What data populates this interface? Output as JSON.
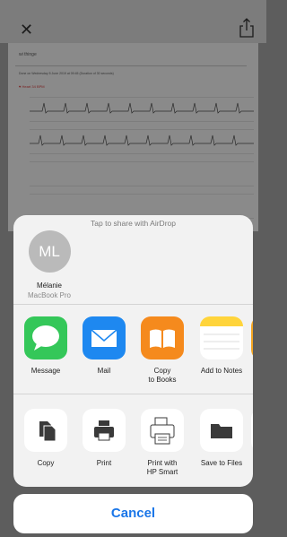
{
  "doc": {
    "user": "wi thinge",
    "meta": "Done on Wednesday 5 June 2019 at 09:45 (Duration of 30 seconds)",
    "heart": "Heart 34 BPM"
  },
  "share": {
    "airdrop_hint": "Tap to share with AirDrop",
    "contact": {
      "initials": "ML",
      "name": "Mélanie",
      "device": "MacBook Pro"
    },
    "apps": [
      {
        "label": "Message",
        "icon": "message-icon",
        "color": "#34c759"
      },
      {
        "label": "Mail",
        "icon": "mail-icon",
        "color": "#1e88f0"
      },
      {
        "label": "Copy\nto Books",
        "icon": "books-icon",
        "color": "#f58a1d"
      },
      {
        "label": "Add to Notes",
        "icon": "notes-icon",
        "color": "#ffd43b"
      }
    ],
    "actions": [
      {
        "label": "Copy",
        "icon": "copy-icon"
      },
      {
        "label": "Print",
        "icon": "print-icon"
      },
      {
        "label": "Print with\nHP Smart",
        "icon": "hp-smart-icon"
      },
      {
        "label": "Save to Files",
        "icon": "folder-icon"
      }
    ]
  },
  "cancel_label": "Cancel"
}
